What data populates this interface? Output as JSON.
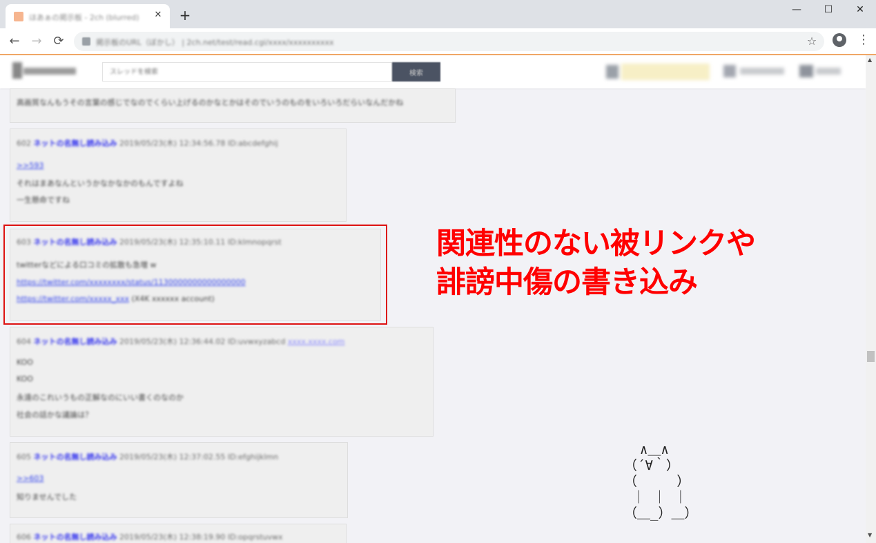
{
  "browser": {
    "tab_title": "ほあぁの掲示板 - 2ch (blurred)",
    "tab_close": "✕",
    "new_tab": "+",
    "window_controls": {
      "minimize": "—",
      "maximize": "☐",
      "close": "✕"
    },
    "nav": {
      "back": "←",
      "forward": "→",
      "reload": "⟳"
    },
    "url": "掲示板のURL（ぼかし） | 2ch.net/test/read.cgi/xxxx/xxxxxxxxxx",
    "star": "☆",
    "menu": "⋮"
  },
  "site": {
    "search_placeholder": "スレッドを検索",
    "search_button": "検索"
  },
  "posts": [
    {
      "lines": [
        {
          "kind": "body",
          "text": "高画質なんもうその言葉の感じでなのでくらい上げるのかなとかはそのでいうのものをいろいろだらいなんだかね"
        }
      ]
    },
    {
      "lines": [
        {
          "kind": "meta",
          "number": "602",
          "name": "ネットの名無し読み込み",
          "info": "2019/05/23(木) 12:34:56.78 ID:abcdefghij"
        },
        {
          "kind": "link",
          "text": ">>593"
        },
        {
          "kind": "body",
          "text": "それはまあなんというかなかなかのもんですよね"
        },
        {
          "kind": "body",
          "text": "一生懸命ですね"
        }
      ]
    },
    {
      "lines": [
        {
          "kind": "meta",
          "number": "603",
          "name": "ネットの名無し読み込み",
          "info": "2019/05/23(木) 12:35:10.11 ID:klmnopqrst"
        },
        {
          "kind": "body",
          "text": "twitterなどによる口コミの拡散も急増 w"
        },
        {
          "kind": "link",
          "text": "https://twitter.com/xxxxxxxx/status/1130000000000000000"
        },
        {
          "kind": "link_tail",
          "text": "https://twitter.com/xxxxx_xxx",
          "tail": "(X4K xxxxxx account)"
        }
      ]
    },
    {
      "lines": [
        {
          "kind": "meta",
          "number": "604",
          "name": "ネットの名無し読み込み",
          "info": "2019/05/23(木) 12:36:44.02 ID:uvwxyzabcd",
          "extra": "xxxx.xxxx.com"
        },
        {
          "kind": "body",
          "text": "KOO"
        },
        {
          "kind": "body",
          "text": "KOO"
        },
        {
          "kind": "body",
          "text": "永遠のこれいうもの正解なのにいい書くのなのか"
        },
        {
          "kind": "body",
          "text": "社会の話かな議論は？"
        }
      ]
    },
    {
      "lines": [
        {
          "kind": "meta",
          "number": "605",
          "name": "ネットの名無し読み込み",
          "info": "2019/05/23(木) 12:37:02.55 ID:efghijklmn"
        },
        {
          "kind": "link",
          "text": ">>603"
        },
        {
          "kind": "body",
          "text": "知りませんでした"
        }
      ]
    },
    {
      "lines": [
        {
          "kind": "meta",
          "number": "606",
          "name": "ネットの名無し読み込み",
          "info": "2019/05/23(木) 12:38:19.90 ID:opqrstuvwx"
        }
      ]
    }
  ],
  "callout": {
    "line1": "関連性のない被リンクや",
    "line2": "誹謗中傷の書き込み"
  },
  "ascii_art": "  ∧＿∧\n（´∀｀）\n（     ）\n ｜ ｜ ｜\n（＿_）＿）",
  "colors": {
    "accent_red": "#ff0000",
    "name_blue": "#3333ee",
    "post_bg": "#efefef"
  }
}
